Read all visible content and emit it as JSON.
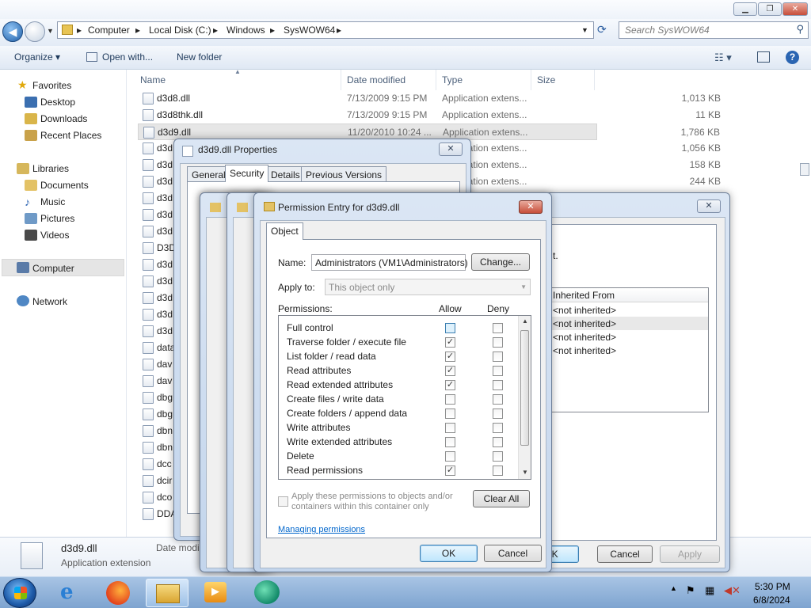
{
  "explorer": {
    "breadcrumb": [
      "Computer",
      "Local Disk (C:)",
      "Windows",
      "SysWOW64"
    ],
    "search_placeholder": "Search SysWOW64",
    "toolbar": {
      "organize": "Organize ▾",
      "open_with": "Open with...",
      "new_folder": "New folder"
    },
    "nav": {
      "favorites": "Favorites",
      "desktop": "Desktop",
      "downloads": "Downloads",
      "recent": "Recent Places",
      "libraries": "Libraries",
      "documents": "Documents",
      "music": "Music",
      "pictures": "Pictures",
      "videos": "Videos",
      "computer": "Computer",
      "network": "Network"
    },
    "columns": {
      "name": "Name",
      "date": "Date modified",
      "type": "Type",
      "size": "Size"
    },
    "files": [
      {
        "name": "d3d8.dll",
        "date": "7/13/2009 9:15 PM",
        "type": "Application extens...",
        "size": "1,013 KB"
      },
      {
        "name": "d3d8thk.dll",
        "date": "7/13/2009 9:15 PM",
        "type": "Application extens...",
        "size": "11 KB"
      },
      {
        "name": "d3d9.dll",
        "date": "11/20/2010 10:24 ...",
        "type": "Application extens...",
        "size": "1,786 KB"
      },
      {
        "name": "d3d",
        "date": "",
        "type": "Application extens...",
        "size": "1,056 KB"
      },
      {
        "name": "d3d",
        "date": "",
        "type": "Application extens...",
        "size": "158 KB"
      },
      {
        "name": "d3d",
        "date": "",
        "type": "Application extens...",
        "size": "244 KB"
      },
      {
        "name": "d3d",
        "date": "",
        "type": "",
        "size": ""
      },
      {
        "name": "d3d",
        "date": "",
        "type": "",
        "size": ""
      },
      {
        "name": "d3d",
        "date": "",
        "type": "",
        "size": ""
      },
      {
        "name": "D3D",
        "date": "",
        "type": "",
        "size": ""
      },
      {
        "name": "d3d",
        "date": "",
        "type": "",
        "size": ""
      },
      {
        "name": "d3d",
        "date": "",
        "type": "",
        "size": ""
      },
      {
        "name": "d3d",
        "date": "",
        "type": "",
        "size": ""
      },
      {
        "name": "d3d",
        "date": "",
        "type": "",
        "size": ""
      },
      {
        "name": "d3d",
        "date": "",
        "type": "",
        "size": ""
      },
      {
        "name": "data",
        "date": "",
        "type": "",
        "size": ""
      },
      {
        "name": "dav",
        "date": "",
        "type": "",
        "size": ""
      },
      {
        "name": "dav",
        "date": "",
        "type": "",
        "size": ""
      },
      {
        "name": "dbg",
        "date": "",
        "type": "",
        "size": ""
      },
      {
        "name": "dbg",
        "date": "",
        "type": "",
        "size": ""
      },
      {
        "name": "dbn",
        "date": "",
        "type": "",
        "size": ""
      },
      {
        "name": "dbn",
        "date": "",
        "type": "",
        "size": ""
      },
      {
        "name": "dcc",
        "date": "",
        "type": "",
        "size": ""
      },
      {
        "name": "dcir",
        "date": "",
        "type": "",
        "size": ""
      },
      {
        "name": "dco",
        "date": "",
        "type": "",
        "size": ""
      },
      {
        "name": "DDA",
        "date": "",
        "type": "",
        "size": ""
      }
    ],
    "details": {
      "filename": "d3d9.dll",
      "filetype": "Application extension",
      "date_label": "Date modi"
    }
  },
  "props": {
    "title": "d3d9.dll Properties",
    "tabs": [
      "General",
      "Security",
      "Details",
      "Previous Versions"
    ],
    "ok": "OK",
    "cancel": "Cancel",
    "apply": "Apply"
  },
  "advanced": {
    "inherited_header": "Inherited From",
    "inherited": [
      "<not inherited>",
      "<not inherited>",
      "<not inherited>",
      "<not inherited>"
    ],
    "tail_text": "t."
  },
  "perm": {
    "title": "Permission Entry for d3d9.dll",
    "tab": "Object",
    "name_label": "Name:",
    "name_value": "Administrators (VM1\\Administrators)",
    "change": "Change...",
    "apply_to_label": "Apply to:",
    "apply_to_value": "This object only",
    "permissions_label": "Permissions:",
    "allow": "Allow",
    "deny": "Deny",
    "rows": [
      {
        "label": "Full control",
        "allow": false,
        "deny": false
      },
      {
        "label": "Traverse folder / execute file",
        "allow": true,
        "deny": false
      },
      {
        "label": "List folder / read data",
        "allow": true,
        "deny": false
      },
      {
        "label": "Read attributes",
        "allow": true,
        "deny": false
      },
      {
        "label": "Read extended attributes",
        "allow": true,
        "deny": false
      },
      {
        "label": "Create files / write data",
        "allow": false,
        "deny": false
      },
      {
        "label": "Create folders / append data",
        "allow": false,
        "deny": false
      },
      {
        "label": "Write attributes",
        "allow": false,
        "deny": false
      },
      {
        "label": "Write extended attributes",
        "allow": false,
        "deny": false
      },
      {
        "label": "Delete",
        "allow": false,
        "deny": false
      },
      {
        "label": "Read permissions",
        "allow": true,
        "deny": false
      }
    ],
    "apply_children": "Apply these permissions to objects and/or containers within this container only",
    "clear_all": "Clear All",
    "managing": "Managing permissions",
    "ok": "OK",
    "cancel": "Cancel"
  },
  "taskbar": {
    "time": "5:30 PM",
    "date": "6/8/2024"
  }
}
